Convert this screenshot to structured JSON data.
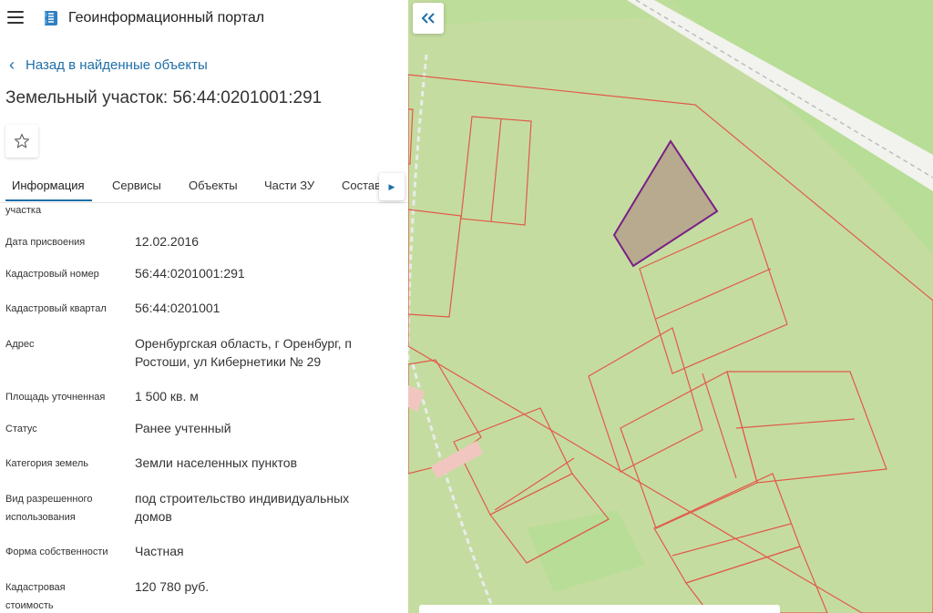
{
  "app": {
    "title": "Геоинформационный портал"
  },
  "nav": {
    "back_label": "Назад в найденные объекты"
  },
  "parcel": {
    "title": "Земельный участок: 56:44:0201001:291"
  },
  "tabs": [
    {
      "label": "Информация",
      "active": true
    },
    {
      "label": "Сервисы"
    },
    {
      "label": "Объекты"
    },
    {
      "label": "Части ЗУ"
    },
    {
      "label": "Состав"
    }
  ],
  "fields": {
    "cut_label": "участка",
    "assign_date": {
      "label": "Дата присвоения",
      "value": "12.02.2016"
    },
    "cad_number": {
      "label": "Кадастровый номер",
      "value": "56:44:0201001:291"
    },
    "cad_quarter": {
      "label": "Кадастровый квартал",
      "value": "56:44:0201001"
    },
    "address": {
      "label": "Адрес",
      "value_line1": "Оренбургская область, г Оренбург, п",
      "value_line2": "Ростоши, ул Кибернетики № 29"
    },
    "area": {
      "label": "Площадь уточненная",
      "value": "1 500 кв. м"
    },
    "status": {
      "label": "Статус",
      "value": "Ранее учтенный"
    },
    "category": {
      "label": "Категория земель",
      "value": "Земли населенных пунктов"
    },
    "usage": {
      "label_line1": "Вид разрешенного",
      "label_line2": "использования",
      "value_line1": "под строительство индивидуальных",
      "value_line2": "домов"
    },
    "ownership": {
      "label": "Форма собственности",
      "value": "Частная"
    },
    "cost": {
      "label_line1": "Кадастровая",
      "label_line2": "стоимость",
      "value": "120 780 руб."
    }
  },
  "icons": {
    "menu": "hamburger-icon",
    "logo": "portal-logo-icon",
    "back": "chevron-left-icon",
    "favorite": "star-outline-icon",
    "tab_scroll": "triangle-right-icon",
    "collapse": "double-chevron-left-icon"
  },
  "colors": {
    "accent": "#1f6fa8",
    "parcel_border": "#e05a4a",
    "selected_fill": "#b7aa8e",
    "selected_border": "#7a1f86",
    "map_bg": "#c5dca0",
    "map_light": "#b8dd96"
  }
}
